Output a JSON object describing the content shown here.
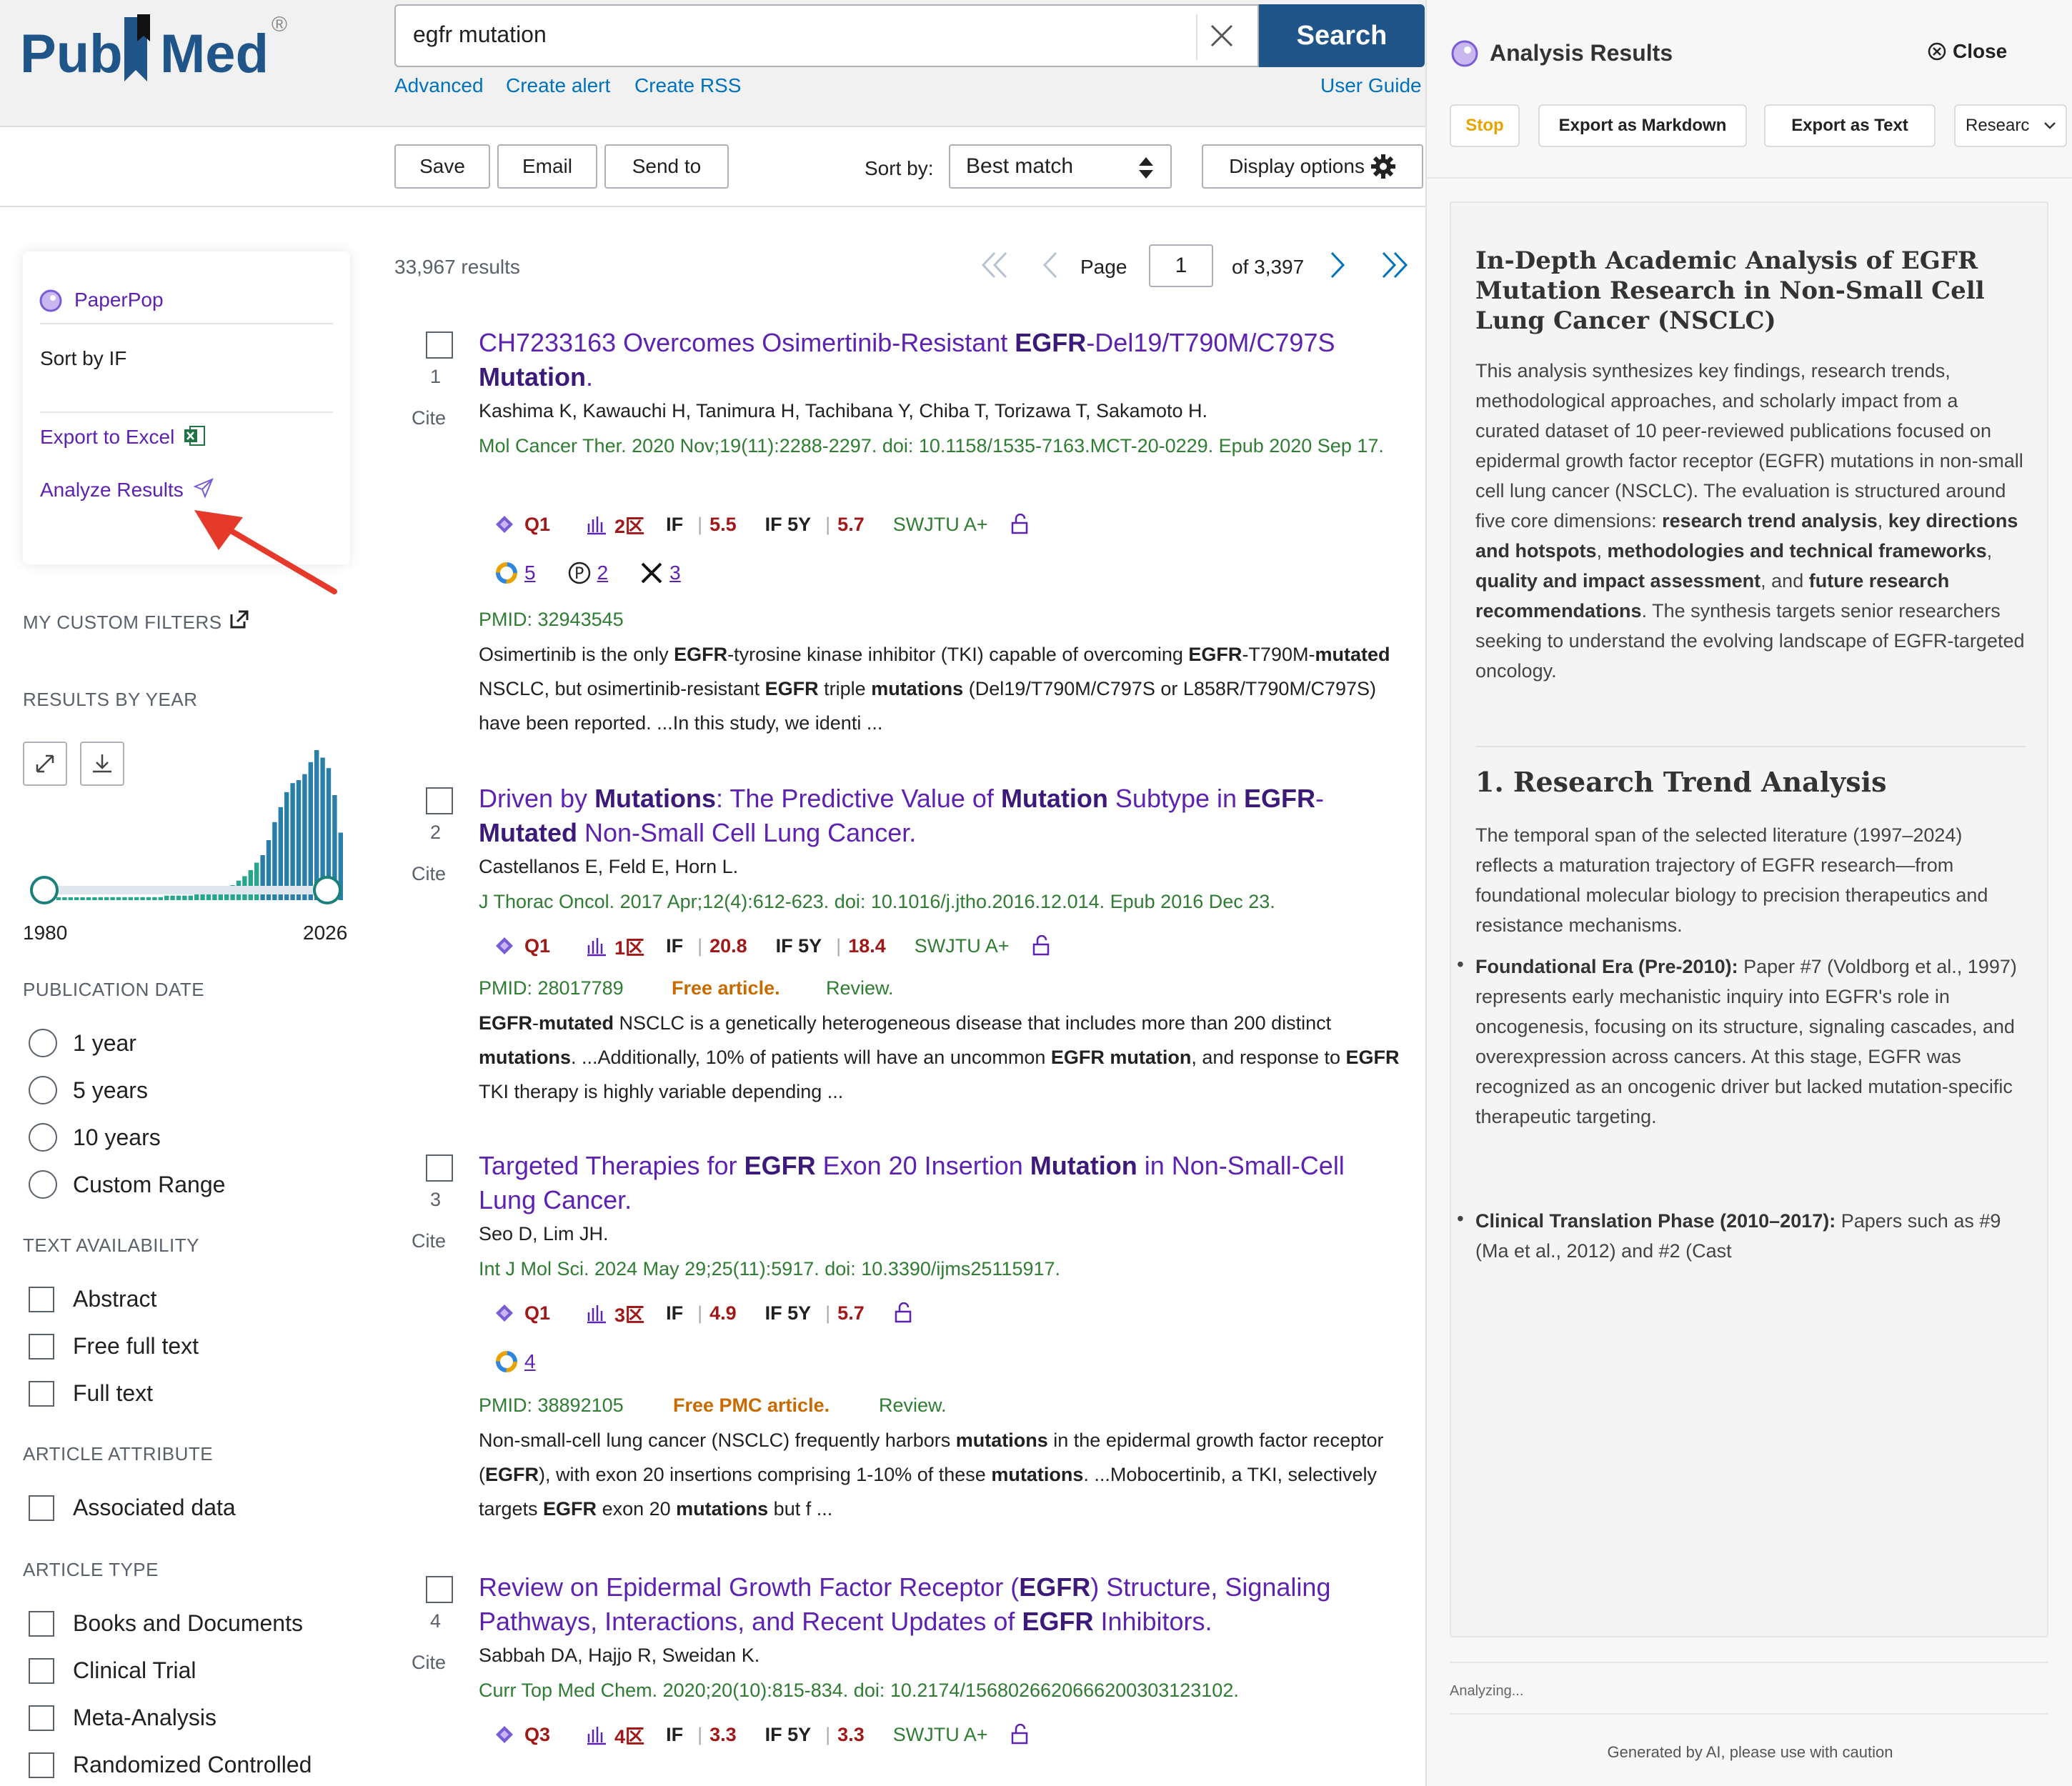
{
  "header": {
    "logo_pub": "Pub",
    "logo_med": "Med",
    "logo_reg": "®",
    "search_value": "egfr mutation",
    "search_button": "Search",
    "links": [
      "Advanced",
      "Create alert",
      "Create RSS"
    ],
    "user_guide": "User Guide"
  },
  "actions": {
    "save": "Save",
    "email": "Email",
    "send_to": "Send to",
    "sort_label": "Sort by:",
    "sort_value": "Best match",
    "display_options": "Display options"
  },
  "sidebar": {
    "paperpop": "PaperPop",
    "sort_by_if": "Sort by IF",
    "export_excel": "Export to Excel",
    "analyze_results": "Analyze Results",
    "custom_filters": "MY CUSTOM FILTERS",
    "results_by_year": "RESULTS BY YEAR",
    "year_start": "1980",
    "year_end": "2026",
    "histogram": [
      1,
      1,
      1,
      1,
      1,
      1,
      1,
      1,
      1,
      2,
      2,
      2,
      2,
      2,
      2,
      2,
      2,
      2,
      2,
      2,
      3,
      3,
      3,
      3,
      3,
      4,
      4,
      4,
      5,
      6,
      8,
      10,
      13,
      16,
      20,
      25,
      30,
      40,
      52,
      62,
      72,
      78,
      80,
      84,
      92,
      100,
      95,
      88,
      70,
      45
    ],
    "publication_date_heading": "PUBLICATION DATE",
    "publication_date": [
      "1 year",
      "5 years",
      "10 years",
      "Custom Range"
    ],
    "text_availability_heading": "TEXT AVAILABILITY",
    "text_availability": [
      "Abstract",
      "Free full text",
      "Full text"
    ],
    "article_attribute_heading": "ARTICLE ATTRIBUTE",
    "article_attribute": [
      "Associated data"
    ],
    "article_type_heading": "ARTICLE TYPE",
    "article_type": [
      "Books and Documents",
      "Clinical Trial",
      "Meta-Analysis",
      "Randomized Controlled"
    ]
  },
  "results": {
    "count": "33,967 results",
    "page_label": "Page",
    "page_value": "1",
    "page_of": "of 3,397",
    "cite": "Cite",
    "articles": [
      {
        "num": "1",
        "title_parts": [
          "CH7233163 Overcomes Osimertinib-Resistant ",
          "EGFR",
          "-Del19/T790M/C797S ",
          "Mutation",
          "."
        ],
        "authors": "Kashima K, Kawauchi H, Tanimura H, Tachibana Y, Chiba T, Torizawa T, Sakamoto H.",
        "journal": "Mol Cancer Ther. 2020 Nov;19(11):2288-2297. doi: 10.1158/1535-7163.MCT-20-0229. Epub 2020 Sep 17.",
        "quartile": "Q1",
        "zone": "2区",
        "if": "5.5",
        "if5": "5.7",
        "swjtu": "SWJTU A+",
        "alt": [
          "5",
          "2",
          "3"
        ],
        "pmid": "PMID: 32943545",
        "snippet_parts": [
          "Osimertinib is the only ",
          "EGFR",
          "-tyrosine kinase inhibitor (TKI) capable of overcoming ",
          "EGFR",
          "-T790M-",
          "mutated",
          " NSCLC, but osimertinib-resistant ",
          "EGFR",
          " triple ",
          "mutations",
          " (Del19/T790M/C797S or L858R/T790M/C797S) have been reported. ...In this study, we identi ..."
        ]
      },
      {
        "num": "2",
        "title_parts": [
          "Driven by ",
          "Mutations",
          ": The Predictive Value of ",
          "Mutation",
          " Subtype in ",
          "EGFR",
          "-",
          "Mutated",
          " Non-Small Cell Lung Cancer."
        ],
        "authors": "Castellanos E, Feld E, Horn L.",
        "journal": "J Thorac Oncol. 2017 Apr;12(4):612-623. doi: 10.1016/j.jtho.2016.12.014. Epub 2016 Dec 23.",
        "quartile": "Q1",
        "zone": "1区",
        "if": "20.8",
        "if5": "18.4",
        "swjtu": "SWJTU A+",
        "pmid": "PMID: 28017789",
        "free": "Free article.",
        "review": "Review.",
        "snippet_parts": [
          "EGFR",
          "-",
          "mutated",
          " NSCLC is a genetically heterogeneous disease that includes more than 200 distinct ",
          "mutations",
          ". ...Additionally, 10% of patients will have an uncommon ",
          "EGFR mutation",
          ", and response to ",
          "EGFR",
          " TKI therapy is highly variable depending ..."
        ]
      },
      {
        "num": "3",
        "title_parts": [
          "Targeted Therapies for ",
          "EGFR",
          " Exon 20 Insertion ",
          "Mutation",
          " in Non-Small-Cell Lung Cancer."
        ],
        "authors": "Seo D, Lim JH.",
        "journal": "Int J Mol Sci. 2024 May 29;25(11):5917. doi: 10.3390/ijms25115917.",
        "quartile": "Q1",
        "zone": "3区",
        "if": "4.9",
        "if5": "5.7",
        "alt": [
          "4"
        ],
        "pmid": "PMID: 38892105",
        "free": "Free PMC article.",
        "review": "Review.",
        "snippet_parts": [
          "Non-small-cell lung cancer (NSCLC) frequently harbors ",
          "mutations",
          " in the epidermal growth factor receptor (",
          "EGFR",
          "), with exon 20 insertions comprising 1-10% of these ",
          "mutations",
          ". ...Mobocertinib, a TKI, selectively targets ",
          "EGFR",
          " exon 20 ",
          "mutations",
          " but f ..."
        ]
      },
      {
        "num": "4",
        "title_parts": [
          "Review on Epidermal Growth Factor Receptor (",
          "EGFR",
          ") Structure, Signaling Pathways, Interactions, and Recent Updates of ",
          "EGFR",
          " Inhibitors."
        ],
        "authors": "Sabbah DA, Hajjo R, Sweidan K.",
        "journal": "Curr Top Med Chem. 2020;20(10):815-834. doi: 10.2174/1568026620666200303123102.",
        "quartile": "Q3",
        "zone": "4区",
        "if": "3.3",
        "if5": "3.3",
        "swjtu": "SWJTU A+"
      }
    ]
  },
  "panel": {
    "title": "Analysis Results",
    "close": "Close",
    "stop": "Stop",
    "export_md": "Export as Markdown",
    "export_text": "Export as Text",
    "research_select": "Researc",
    "h1": "In-Depth Academic Analysis of EGFR Mutation Research in Non-Small Cell Lung Cancer (NSCLC)",
    "intro_parts": [
      "This analysis synthesizes key findings, research trends, methodological approaches, and scholarly impact from a curated dataset of 10 peer-reviewed publications focused on epidermal growth factor receptor (EGFR) mutations in non-small cell lung cancer (NSCLC). The evaluation is structured around five core dimensions: ",
      "research trend analysis",
      ", ",
      "key directions and hotspots",
      ", ",
      "methodologies and technical frameworks",
      ", ",
      "quality and impact assessment",
      ", and ",
      "future research recommendations",
      ". The synthesis targets senior researchers seeking to understand the evolving landscape of EGFR-targeted oncology."
    ],
    "h2": "1. Research Trend Analysis",
    "p2": "The temporal span of the selected literature (1997–2024) reflects a maturation trajectory of EGFR research—from foundational molecular biology to precision therapeutics and resistance mechanisms.",
    "bullet1_head": "Foundational Era (Pre-2010):",
    "bullet1_body": " Paper #7 (Voldborg et al., 1997) represents early mechanistic inquiry into EGFR's role in oncogenesis, focusing on its structure, signaling cascades, and overexpression across cancers. At this stage, EGFR was recognized as an oncogenic driver but lacked mutation-specific therapeutic targeting.",
    "bullet2_head": "Clinical Translation Phase (2010–2017):",
    "bullet2_body": " Papers such as #9 (Ma et al., 2012) and #2 (Cast",
    "analyzing": "Analyzing...",
    "generated": "Generated by AI, please use with caution"
  },
  "colors": {
    "brand": "#20558a",
    "link": "#0071bc",
    "title_purple": "#5e22b1",
    "green": "#2f7d32",
    "red": "#a01818"
  }
}
